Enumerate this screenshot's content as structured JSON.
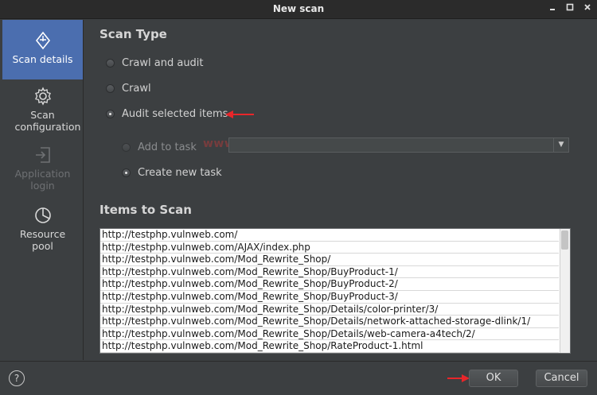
{
  "window": {
    "title": "New scan",
    "controls": [
      "minimize-icon",
      "maximize-icon",
      "close-icon"
    ]
  },
  "sidebar": {
    "items": [
      {
        "label": "Scan details",
        "icon": "scan-details-icon",
        "active": true,
        "enabled": true
      },
      {
        "label": "Scan configuration",
        "icon": "gear-icon",
        "active": false,
        "enabled": true
      },
      {
        "label": "Application login",
        "icon": "login-icon",
        "active": false,
        "enabled": false
      },
      {
        "label": "Resource pool",
        "icon": "pie-chart-icon",
        "active": false,
        "enabled": true
      }
    ]
  },
  "scan_type": {
    "heading": "Scan Type",
    "options": [
      {
        "label": "Crawl and audit",
        "checked": false
      },
      {
        "label": "Crawl",
        "checked": false
      },
      {
        "label": "Audit selected items",
        "checked": true
      }
    ],
    "task_options": [
      {
        "label": "Add to task",
        "checked": false,
        "enabled": false
      },
      {
        "label": "Create new task",
        "checked": true,
        "enabled": true
      }
    ],
    "task_select_value": ""
  },
  "items_to_scan": {
    "heading": "Items to Scan",
    "items": [
      "http://testphp.vulnweb.com/",
      "http://testphp.vulnweb.com/AJAX/index.php",
      "http://testphp.vulnweb.com/Mod_Rewrite_Shop/",
      "http://testphp.vulnweb.com/Mod_Rewrite_Shop/BuyProduct-1/",
      "http://testphp.vulnweb.com/Mod_Rewrite_Shop/BuyProduct-2/",
      "http://testphp.vulnweb.com/Mod_Rewrite_Shop/BuyProduct-3/",
      "http://testphp.vulnweb.com/Mod_Rewrite_Shop/Details/color-printer/3/",
      "http://testphp.vulnweb.com/Mod_Rewrite_Shop/Details/network-attached-storage-dlink/1/",
      "http://testphp.vulnweb.com/Mod_Rewrite_Shop/Details/web-camera-a4tech/2/",
      "http://testphp.vulnweb.com/Mod_Rewrite_Shop/RateProduct-1.html"
    ]
  },
  "footer": {
    "help_label": "?",
    "ok_label": "OK",
    "cancel_label": "Cancel"
  },
  "watermark": "www.hackingarticles.in",
  "colors": {
    "background": "#3c3f41",
    "sidebar_active": "#4b6eaf",
    "annotation_arrow": "#e8262a"
  }
}
